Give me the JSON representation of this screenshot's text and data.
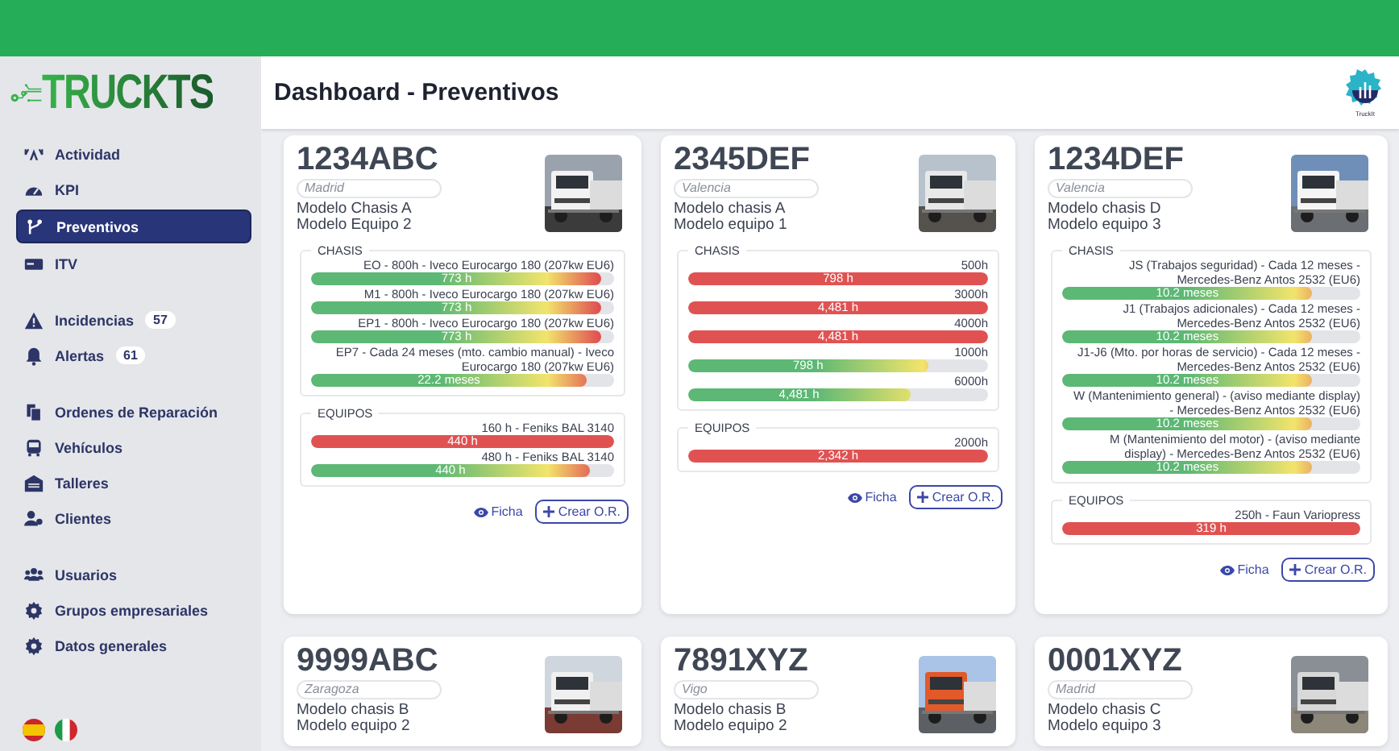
{
  "header": {
    "title": "Dashboard - Preventivos",
    "brand_caption": "TruckIt"
  },
  "sidebar": {
    "logo": "TRUCKTS",
    "groups": [
      {
        "items": [
          {
            "label": "Actividad",
            "selected": false
          },
          {
            "label": "KPI",
            "selected": false
          },
          {
            "label": "Preventivos",
            "selected": true
          },
          {
            "label": "ITV",
            "selected": false
          }
        ]
      },
      {
        "items": [
          {
            "label": "Incidencias",
            "selected": false,
            "badge": "57"
          },
          {
            "label": "Alertas",
            "selected": false,
            "badge": "61"
          }
        ]
      },
      {
        "items": [
          {
            "label": "Ordenes de Reparación",
            "selected": false
          },
          {
            "label": "Vehículos",
            "selected": false
          },
          {
            "label": "Talleres",
            "selected": false
          },
          {
            "label": "Clientes",
            "selected": false
          }
        ]
      },
      {
        "items": [
          {
            "label": "Usuarios",
            "selected": false
          },
          {
            "label": "Grupos empresariales",
            "selected": false
          },
          {
            "label": "Datos generales",
            "selected": false
          }
        ]
      }
    ]
  },
  "cards": [
    {
      "plate": "1234ABC",
      "location": "Madrid",
      "models": [
        "Modelo Chasis A",
        "Modelo Equipo 2"
      ],
      "photo": {
        "kind": "picture"
      },
      "sections": [
        {
          "title": "CHASIS",
          "items": [
            {
              "label": "EO - 800h - Iveco Eurocargo 180 (207kw EU6)",
              "reading": "773 h",
              "level": 0.96
            },
            {
              "label": "M1 - 800h - Iveco Eurocargo 180 (207kw EU6)",
              "reading": "773 h",
              "level": 0.96
            },
            {
              "label": "EP1 - 800h - Iveco Eurocargo 180 (207kw EU6)",
              "reading": "773 h",
              "level": 0.96
            },
            {
              "label": "EP7 - Cada 24 meses (mto. cambio manual) - Iveco Eurocargo 180 (207kw EU6)",
              "reading": "22.2 meses",
              "level": 0.91
            }
          ]
        },
        {
          "title": "EQUIPOS",
          "items": [
            {
              "label": "160 h - Feniks BAL 3140",
              "reading": "440 h",
              "level": 1
            },
            {
              "label": "480 h - Feniks BAL 3140",
              "reading": "440 h",
              "level": 0.92
            }
          ]
        }
      ],
      "actions": {
        "view": "Ficha",
        "create": "Crear O.R."
      }
    },
    {
      "plate": "2345DEF",
      "location": "Valencia",
      "models": [
        "Modelo chasis A",
        "Modelo equipo 1"
      ],
      "photo": {
        "kind": "picture"
      },
      "sections": [
        {
          "title": "CHASIS",
          "items": [
            {
              "label": "500h",
              "reading": "798 h",
              "level": 1
            },
            {
              "label": "3000h",
              "reading": "4,481 h",
              "level": 1
            },
            {
              "label": "4000h",
              "reading": "4,481 h",
              "level": 1
            },
            {
              "label": "1000h",
              "reading": "798 h",
              "level": 0.8
            },
            {
              "label": "6000h",
              "reading": "4,481 h",
              "level": 0.74
            }
          ]
        },
        {
          "title": "EQUIPOS",
          "items": [
            {
              "label": "2000h",
              "reading": "2,342 h",
              "level": 1
            }
          ]
        }
      ],
      "actions": {
        "view": "Ficha",
        "create": "Crear O.R."
      }
    },
    {
      "plate": "1234DEF",
      "location": "Valencia",
      "models": [
        "Modelo chasis D",
        "Modelo equipo 3"
      ],
      "photo": {
        "kind": "picture"
      },
      "sections": [
        {
          "title": "CHASIS",
          "items": [
            {
              "label": "JS (Trabajos seguridad) - Cada 12 meses - Mercedes-Benz Antos 2532 (EU6)",
              "reading": "10.2 meses",
              "level": 0.84
            },
            {
              "label": "J1 (Trabajos adicionales) - Cada 12 meses - Mercedes-Benz Antos 2532 (EU6)",
              "reading": "10.2 meses",
              "level": 0.84
            },
            {
              "label": "J1-J6 (Mto. por horas de servicio) - Cada 12 meses - Mercedes-Benz Antos 2532 (EU6)",
              "reading": "10.2 meses",
              "level": 0.84
            },
            {
              "label": "W (Mantenimiento general) - (aviso mediante display) - Mercedes-Benz Antos 2532 (EU6)",
              "reading": "10.2 meses",
              "level": 0.84
            },
            {
              "label": "M (Mantenimiento del motor) - (aviso mediante display) - Mercedes-Benz Antos 2532 (EU6)",
              "reading": "10.2 meses",
              "level": 0.84
            }
          ]
        },
        {
          "title": "EQUIPOS",
          "items": [
            {
              "label": "250h - Faun Variopress",
              "reading": "319 h",
              "level": 1
            }
          ]
        }
      ],
      "actions": {
        "view": "Ficha",
        "create": "Crear O.R."
      }
    },
    {
      "plate": "9999ABC",
      "location": "Zaragoza",
      "models": [
        "Modelo chasis B",
        "Modelo equipo 2"
      ],
      "photo": {
        "kind": "picture"
      }
    },
    {
      "plate": "7891XYZ",
      "location": "Vigo",
      "models": [
        "Modelo chasis B",
        "Modelo equipo 2"
      ],
      "photo": {
        "kind": "picture"
      }
    },
    {
      "plate": "0001XYZ",
      "location": "Madrid",
      "models": [
        "Modelo chasis C",
        "Modelo equipo 3"
      ],
      "photo": {
        "kind": "picture"
      }
    }
  ]
}
